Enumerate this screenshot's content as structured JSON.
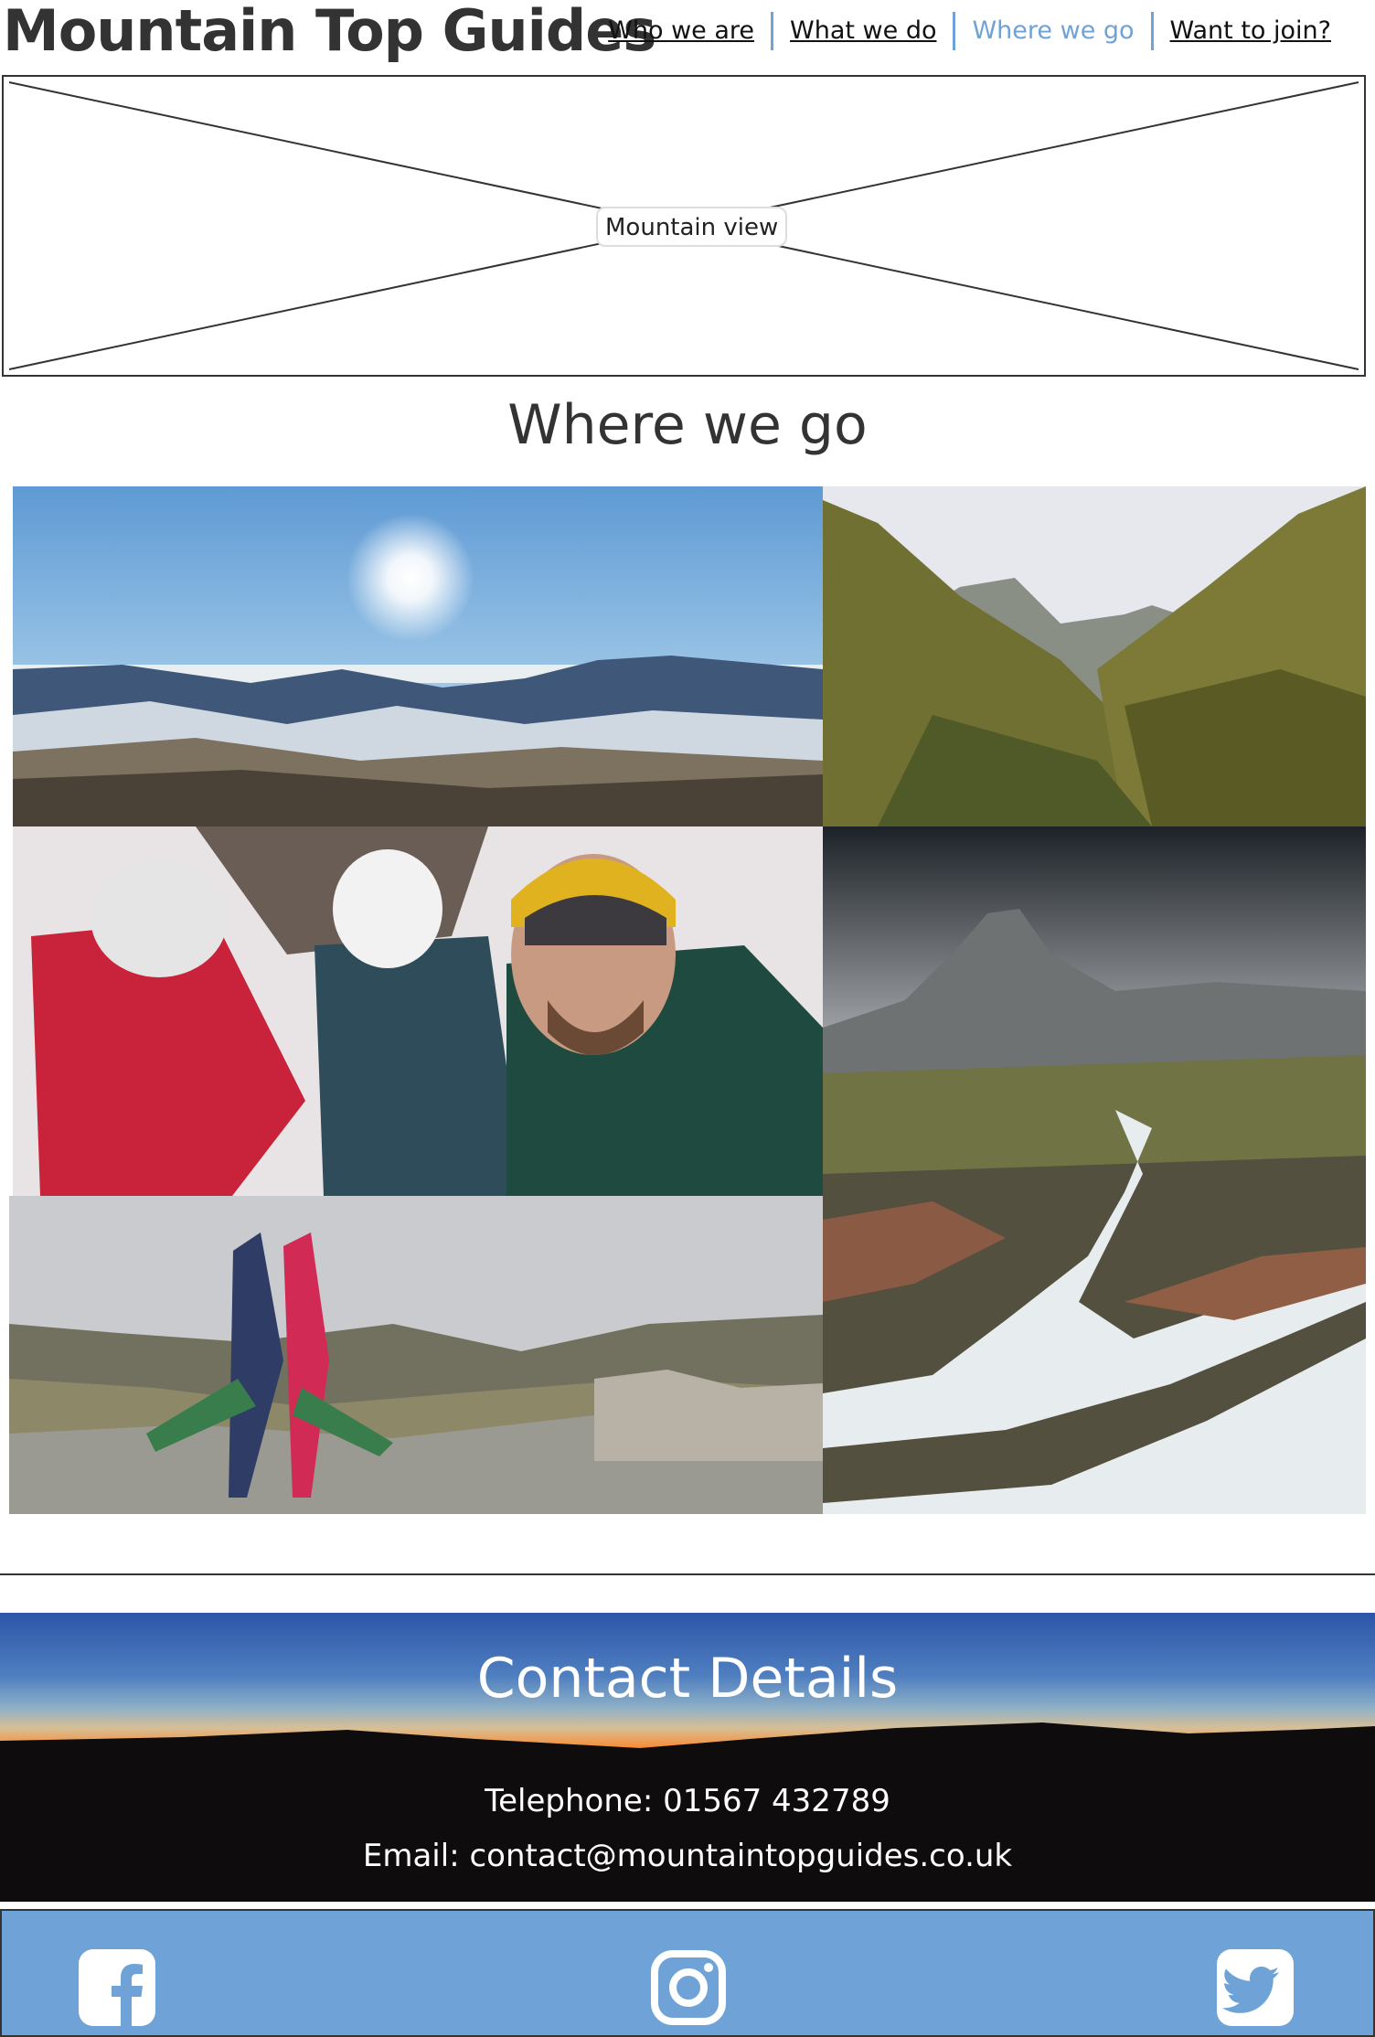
{
  "header": {
    "logo": "Mountain Top Guides",
    "nav": [
      {
        "label": "Who we are",
        "active": false
      },
      {
        "label": "What we do",
        "active": false
      },
      {
        "label": "Where we go",
        "active": true
      },
      {
        "label": "Want to join?",
        "active": false
      }
    ]
  },
  "hero": {
    "alt": "Mountain view"
  },
  "main": {
    "title": "Where we go"
  },
  "contact": {
    "title": "Contact Details",
    "phone": "Telephone: 01567 432789",
    "email": "Email: contact@mountaintopguides.co.uk"
  },
  "footer": {
    "social": [
      {
        "icon": "facebook-icon"
      },
      {
        "icon": "instagram-icon"
      },
      {
        "icon": "twitter-icon"
      }
    ]
  },
  "colors": {
    "accent": "#6fa3d7",
    "text": "#333333",
    "footer_bg": "#6fa3d7"
  }
}
